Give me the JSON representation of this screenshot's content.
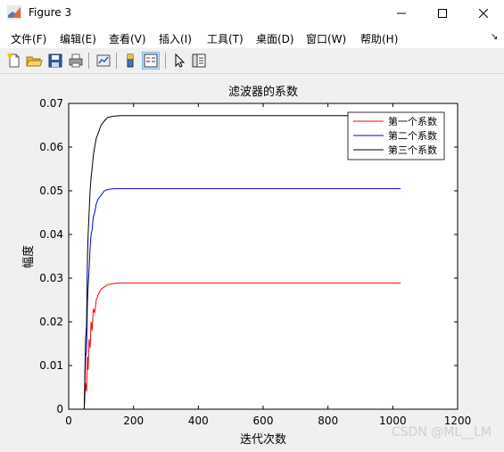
{
  "window": {
    "title": "Figure 3"
  },
  "menu": [
    "文件(F)",
    "编辑(E)",
    "查看(V)",
    "插入(I)",
    "工具(T)",
    "桌面(D)",
    "窗口(W)",
    "帮助(H)"
  ],
  "toolbar": {
    "buttons": [
      "new-figure-icon",
      "open-folder-icon",
      "save-icon",
      "print-icon",
      "link-plot-icon",
      "insert-colorbar-icon",
      "insert-legend-icon",
      "pointer-icon",
      "property-editor-icon"
    ]
  },
  "colors": {
    "series1": "#ff0000",
    "series2": "#0000ff",
    "series3": "#000000"
  },
  "chart_data": {
    "type": "line",
    "title": "滤波器的系数",
    "xlabel": "迭代次数",
    "ylabel": "幅度",
    "xlim": [
      0,
      1200
    ],
    "ylim": [
      0,
      0.07
    ],
    "xticks": [
      0,
      200,
      400,
      600,
      800,
      1000,
      1200
    ],
    "yticks": [
      0,
      0.01,
      0.02,
      0.03,
      0.04,
      0.05,
      0.06,
      0.07
    ],
    "legend_position": "top-right",
    "grid": false,
    "series": [
      {
        "name": "第一个系数",
        "color": "#ff0000",
        "x": [
          0,
          48,
          52,
          55,
          58,
          60,
          63,
          66,
          69,
          72,
          76,
          80,
          85,
          90,
          100,
          110,
          120,
          140,
          160,
          200,
          400,
          600,
          800,
          1024
        ],
        "y": [
          0,
          0,
          0.006,
          0.004,
          0.012,
          0.009,
          0.016,
          0.014,
          0.02,
          0.018,
          0.023,
          0.022,
          0.025,
          0.026,
          0.0275,
          0.028,
          0.0285,
          0.0288,
          0.0289,
          0.0289,
          0.0289,
          0.0289,
          0.0289,
          0.0289
        ]
      },
      {
        "name": "第二个系数",
        "color": "#0000ff",
        "x": [
          0,
          48,
          52,
          55,
          58,
          60,
          63,
          66,
          69,
          72,
          76,
          80,
          85,
          90,
          100,
          110,
          120,
          140,
          160,
          200,
          400,
          600,
          800,
          1024
        ],
        "y": [
          0,
          0,
          0.012,
          0.013,
          0.025,
          0.028,
          0.032,
          0.037,
          0.04,
          0.041,
          0.044,
          0.045,
          0.047,
          0.048,
          0.049,
          0.05,
          0.0503,
          0.0505,
          0.0505,
          0.0505,
          0.0505,
          0.0505,
          0.0505,
          0.0505
        ]
      },
      {
        "name": "第三个系数",
        "color": "#000000",
        "x": [
          0,
          48,
          52,
          55,
          58,
          60,
          63,
          66,
          69,
          72,
          76,
          80,
          85,
          90,
          100,
          110,
          120,
          140,
          160,
          200,
          400,
          600,
          800,
          1024
        ],
        "y": [
          0,
          0,
          0.016,
          0.019,
          0.035,
          0.04,
          0.045,
          0.05,
          0.053,
          0.055,
          0.058,
          0.06,
          0.062,
          0.063,
          0.065,
          0.066,
          0.0668,
          0.0671,
          0.0672,
          0.0672,
          0.0672,
          0.0672,
          0.0672,
          0.0672
        ]
      }
    ]
  }
}
